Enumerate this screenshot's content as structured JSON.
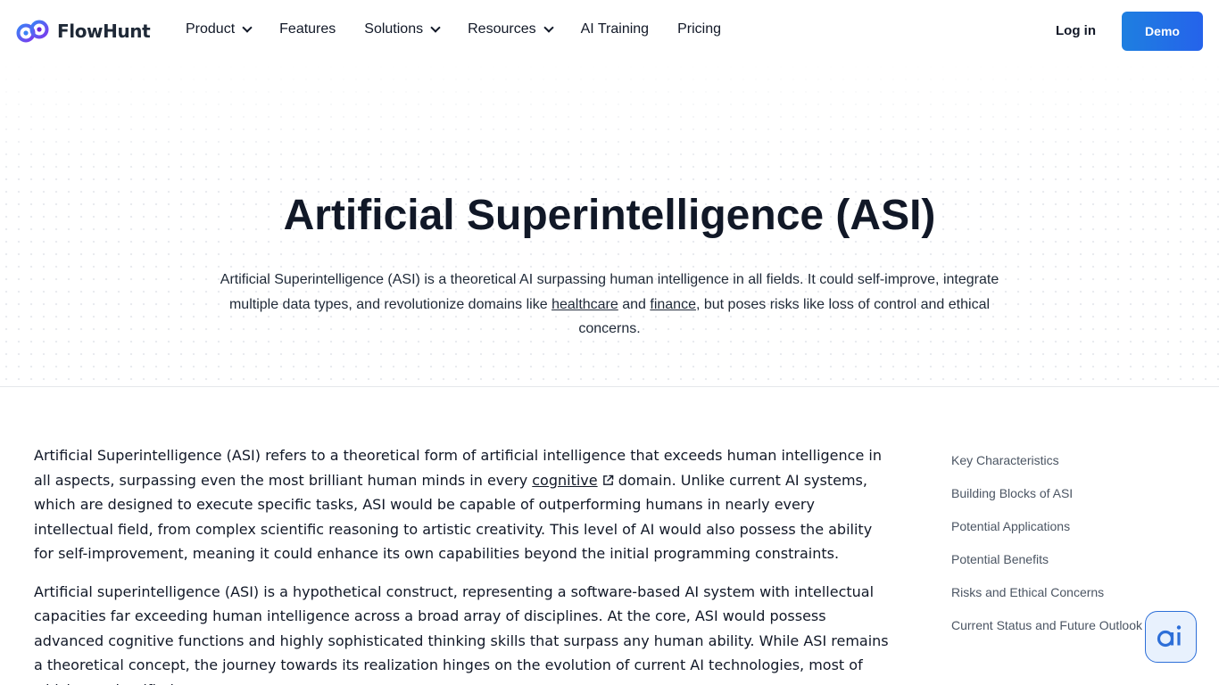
{
  "brand": {
    "name": "FlowHunt"
  },
  "nav": {
    "items": [
      {
        "label": "Product",
        "dropdown": true
      },
      {
        "label": "Features",
        "dropdown": false
      },
      {
        "label": "Solutions",
        "dropdown": true
      },
      {
        "label": "Resources",
        "dropdown": true
      },
      {
        "label": "AI Training",
        "dropdown": false
      },
      {
        "label": "Pricing",
        "dropdown": false
      }
    ],
    "login_label": "Log in",
    "demo_label": "Demo"
  },
  "hero": {
    "title": "Artificial Superintelligence (ASI)",
    "desc_part1": "Artificial Superintelligence (ASI) is a theoretical AI surpassing human intelligence in all fields. It could self-improve, integrate multiple data types, and revolutionize domains like ",
    "link_healthcare": "healthcare",
    "desc_and": " and ",
    "link_finance": "finance",
    "desc_part2": ", but poses risks like loss of control and ethical concerns."
  },
  "article": {
    "p1_a": "Artificial Superintelligence (ASI) refers to a theoretical form of artificial intelligence that exceeds human intelligence in all aspects, surpassing even the most brilliant human minds in every ",
    "p1_link": "cognitive",
    "p1_b": " domain. Unlike current AI systems, which are designed to execute specific tasks, ASI would be capable of outperforming humans in nearly every intellectual field, from complex scientific reasoning to artistic creativity. This level of AI would also possess the ability for self-improvement, meaning it could enhance its own capabilities beyond the initial programming constraints.",
    "p2": "Artificial superintelligence (ASI) is a hypothetical construct, representing a software-based AI system with intellectual capacities far exceeding human intelligence across a broad array of disciplines. At the core, ASI would possess advanced cognitive functions and highly sophisticated thinking skills that surpass any human ability. While ASI remains a theoretical concept, the journey towards its realization hinges on the evolution of current AI technologies, most of which are classified"
  },
  "toc": {
    "items": [
      "Key Characteristics",
      "Building Blocks of ASI",
      "Potential Applications",
      "Potential Benefits",
      "Risks and Ethical Concerns",
      "Current Status and Future Outlook"
    ]
  },
  "colors": {
    "accent": "#2563eb",
    "text": "#111827",
    "muted": "#4b5563"
  },
  "icons": {
    "chat_widget": "ai-chat-icon",
    "external_link": "external-link-icon"
  }
}
